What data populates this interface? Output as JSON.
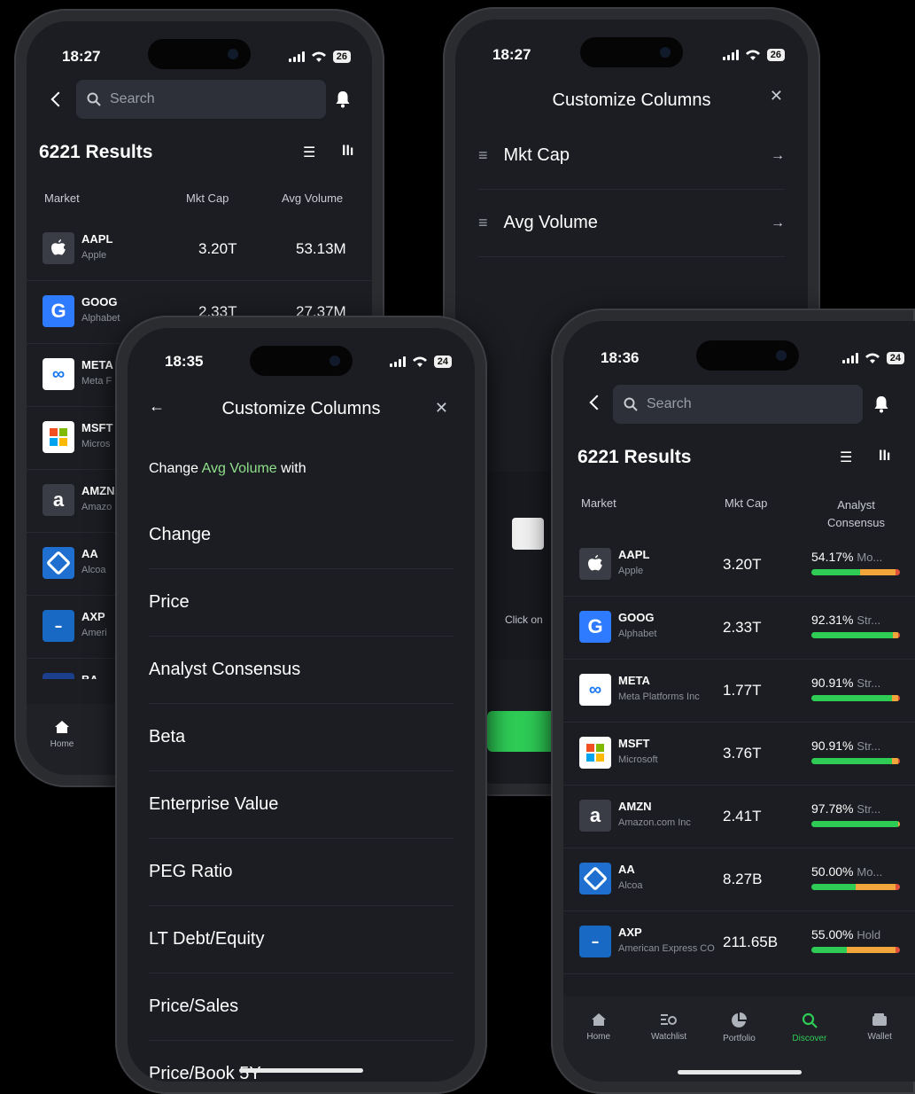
{
  "colors": {
    "green": "#2ecc55",
    "orange": "#f2a53a",
    "red": "#e0513a",
    "accent_text": "#8fe08a"
  },
  "phone1": {
    "time": "18:27",
    "battery": "26",
    "search_placeholder": "Search",
    "results_title": "6221 Results",
    "columns": {
      "market": "Market",
      "mktcap": "Mkt Cap",
      "avgvol": "Avg Volume"
    },
    "rows": [
      {
        "ticker": "AAPL",
        "name": "Apple",
        "mktcap": "3.20T",
        "avgvol": "53.13M",
        "logo": "apple-icon"
      },
      {
        "ticker": "GOOG",
        "name": "Alphabet",
        "mktcap": "2.33T",
        "avgvol": "27.37M",
        "logo": "google-icon"
      },
      {
        "ticker": "META",
        "name": "Meta F",
        "logo": "meta-icon"
      },
      {
        "ticker": "MSFT",
        "name": "Micros",
        "logo": "microsoft-icon"
      },
      {
        "ticker": "AMZN",
        "name": "Amazo",
        "logo": "amazon-icon"
      },
      {
        "ticker": "AA",
        "name": "Alcoa",
        "logo": "alcoa-icon"
      },
      {
        "ticker": "AXP",
        "name": "Ameri",
        "logo": "amex-icon"
      },
      {
        "ticker": "BA"
      }
    ],
    "tab_home": "Home"
  },
  "phone2": {
    "time": "18:27",
    "battery": "26",
    "title": "Customize Columns",
    "columns": [
      "Mkt Cap",
      "Avg Volume"
    ],
    "click_hint": "Click on"
  },
  "phone3": {
    "time": "18:35",
    "battery": "24",
    "title": "Customize Columns",
    "change_prefix": "Change",
    "change_target": "Avg Volume",
    "change_suffix": "with",
    "options": [
      "Change",
      "Price",
      "Analyst Consensus",
      "Beta",
      "Enterprise Value",
      "PEG Ratio",
      "LT Debt/Equity",
      "Price/Sales",
      "Price/Book 5Y"
    ]
  },
  "phone4": {
    "time": "18:36",
    "battery": "24",
    "search_placeholder": "Search",
    "results_title": "6221 Results",
    "columns": {
      "market": "Market",
      "mktcap": "Mkt Cap",
      "consensus_line1": "Analyst",
      "consensus_line2": "Consensus"
    },
    "rows": [
      {
        "ticker": "AAPL",
        "name": "Apple",
        "mktcap": "3.20T",
        "pct": "54.17%",
        "label": "Mo...",
        "green": 0.55,
        "orange": 0.4,
        "red": 0.05
      },
      {
        "ticker": "GOOG",
        "name": "Alphabet",
        "mktcap": "2.33T",
        "pct": "92.31%",
        "label": "Str...",
        "green": 0.92,
        "orange": 0.06,
        "red": 0.02
      },
      {
        "ticker": "META",
        "name": "Meta Platforms Inc",
        "mktcap": "1.77T",
        "pct": "90.91%",
        "label": "Str...",
        "green": 0.91,
        "orange": 0.07,
        "red": 0.02
      },
      {
        "ticker": "MSFT",
        "name": "Microsoft",
        "mktcap": "3.76T",
        "pct": "90.91%",
        "label": "Str...",
        "green": 0.91,
        "orange": 0.07,
        "red": 0.02
      },
      {
        "ticker": "AMZN",
        "name": "Amazon.com Inc",
        "mktcap": "2.41T",
        "pct": "97.78%",
        "label": "Str...",
        "green": 0.98,
        "orange": 0.02,
        "red": 0.0
      },
      {
        "ticker": "AA",
        "name": "Alcoa",
        "mktcap": "8.27B",
        "pct": "50.00%",
        "label": "Mo...",
        "green": 0.5,
        "orange": 0.45,
        "red": 0.05
      },
      {
        "ticker": "AXP",
        "name": "American Express CO",
        "mktcap": "211.65B",
        "pct": "55.00%",
        "label": "Hold",
        "green": 0.4,
        "orange": 0.55,
        "red": 0.05
      }
    ],
    "tabs": [
      "Home",
      "Watchlist",
      "Portfolio",
      "Discover",
      "Wallet"
    ],
    "active_tab": "Discover"
  }
}
